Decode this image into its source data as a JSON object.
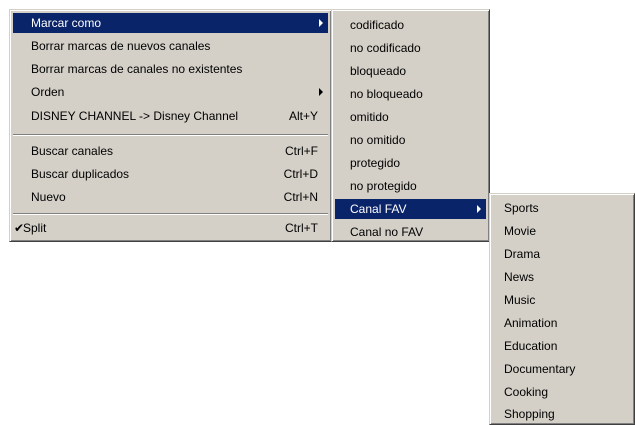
{
  "main_menu": {
    "items": [
      {
        "label": "Marcar como"
      },
      {
        "label": "Borrar marcas de nuevos canales"
      },
      {
        "label": "Borrar marcas de canales no existentes"
      },
      {
        "label": "Orden"
      },
      {
        "label": "DISNEY CHANNEL -> Disney Channel",
        "shortcut": "Alt+Y"
      },
      {
        "label": "Buscar canales",
        "shortcut": "Ctrl+F"
      },
      {
        "label": "Buscar duplicados",
        "shortcut": "Ctrl+D"
      },
      {
        "label": "Nuevo",
        "shortcut": "Ctrl+N"
      },
      {
        "label": "Split",
        "shortcut": "Ctrl+T",
        "check": "✔"
      }
    ]
  },
  "marcar_menu": {
    "items": [
      {
        "label": "codificado"
      },
      {
        "label": "no codificado"
      },
      {
        "label": "bloqueado"
      },
      {
        "label": "no bloqueado"
      },
      {
        "label": "omitido"
      },
      {
        "label": "no omitido"
      },
      {
        "label": "protegido"
      },
      {
        "label": "no protegido"
      },
      {
        "label": "Canal FAV"
      },
      {
        "label": "Canal no FAV"
      }
    ]
  },
  "fav_menu": {
    "items": [
      {
        "label": "Sports"
      },
      {
        "label": "Movie"
      },
      {
        "label": "Drama"
      },
      {
        "label": "News"
      },
      {
        "label": "Music"
      },
      {
        "label": "Animation"
      },
      {
        "label": "Education"
      },
      {
        "label": "Documentary"
      },
      {
        "label": "Cooking"
      },
      {
        "label": "Shopping"
      }
    ]
  },
  "colors": {
    "menu_bg": "#d4d0c8",
    "highlight_bg": "#0a246a",
    "highlight_text": "#ffffff"
  }
}
